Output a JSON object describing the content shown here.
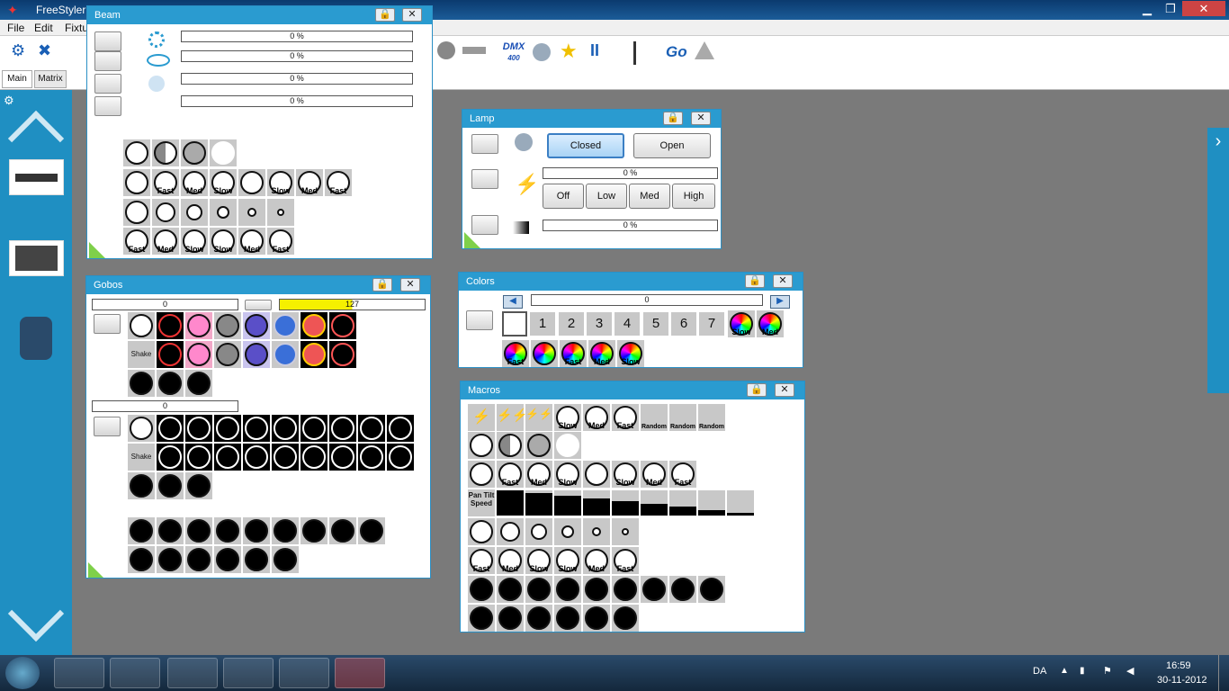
{
  "app": {
    "title": "FreeStyler",
    "min": "▁",
    "max": "❐",
    "close": "✕"
  },
  "menu": {
    "file": "File",
    "edit": "Edit",
    "fixtures": "Fixtu"
  },
  "tabs": {
    "main": "Main",
    "matrix": "Matrix"
  },
  "toolbar": {
    "dmx": "DMX",
    "dmx_sub": "400",
    "go": "Go",
    "pause": "II"
  },
  "beam": {
    "title": "Beam",
    "bars": [
      "0 %",
      "0 %",
      "0 %",
      "0 %"
    ],
    "row2": [
      "",
      "Fast",
      "Med",
      "Slow",
      "",
      "Slow",
      "Med",
      "Fast"
    ],
    "row4": [
      "Fast",
      "Med",
      "Slow",
      "Slow",
      "Med",
      "Fast"
    ]
  },
  "lamp": {
    "title": "Lamp",
    "closed": "Closed",
    "open": "Open",
    "bar1": "0 %",
    "bar2": "0 %",
    "off": "Off",
    "low": "Low",
    "med": "Med",
    "high": "High"
  },
  "gobos": {
    "title": "Gobos",
    "bar1": "0",
    "bar2": "127",
    "bar3": "0",
    "shake": "Shake",
    "shake2": "Shake"
  },
  "colors": {
    "title": "Colors",
    "bar": "0",
    "numbers": [
      "1",
      "2",
      "3",
      "4",
      "5",
      "6",
      "7"
    ],
    "row1_labels": [
      "Slow",
      "Med"
    ],
    "row2_labels": [
      "Fast",
      "",
      "Fast",
      "Med",
      "Slow"
    ]
  },
  "macros": {
    "title": "Macros",
    "row1": [
      "",
      "",
      "",
      "Slow",
      "Med",
      "Fast",
      "Random",
      "Random",
      "Random"
    ],
    "row3": [
      "",
      "Fast",
      "Med",
      "Slow",
      "",
      "Slow",
      "Med",
      "Fast"
    ],
    "pts": "Pan Tilt Speed",
    "row6": [
      "Fast",
      "Med",
      "Slow",
      "Slow",
      "Med",
      "Fast"
    ]
  },
  "taskbar": {
    "lang": "DA",
    "time": "16:59",
    "date": "30-11-2012"
  },
  "colors_theme": {
    "accent": "#2a9bd0",
    "sidebar": "#1f8fc2",
    "bg": "#7a7a7a"
  }
}
